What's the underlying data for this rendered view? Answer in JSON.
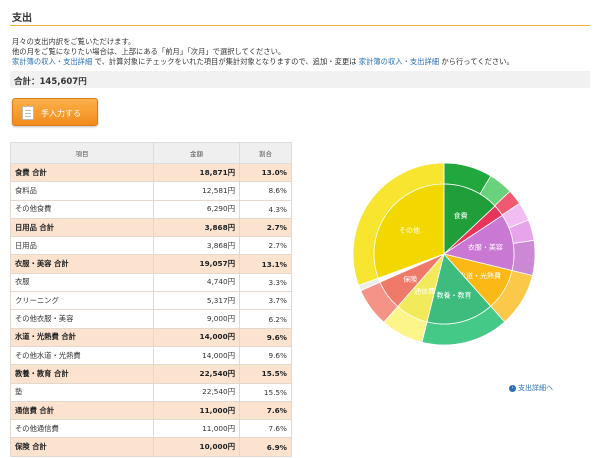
{
  "header": {
    "title": "支出"
  },
  "description": {
    "line1": "月々の支出内訳をご覧いただけます。",
    "line2": "他の月をご覧になりたい場合は、上部にある「前月」「次月」で選択してください。",
    "line3_link1": "家計簿の収入・支出詳細",
    "line3_mid": " で、計算対象にチェックをいれた項目が集計対象となりますので、追加・変更は ",
    "line3_link2": "家計簿の収入・支出詳細",
    "line3_end": " から行ってください。"
  },
  "total": {
    "label": "合計：145,607円"
  },
  "input_button": {
    "label": "手入力する",
    "icon": "note-icon"
  },
  "table": {
    "headers": [
      "項目",
      "金額",
      "割合"
    ],
    "rows": [
      {
        "type": "sub",
        "name": "食費 合計",
        "amount": "18,871円",
        "ratio": "13.0%"
      },
      {
        "type": "item",
        "name": "食料品",
        "amount": "12,581円",
        "ratio": "8.6%"
      },
      {
        "type": "item",
        "name": "その他食費",
        "amount": "6,290円",
        "ratio": "4.3%"
      },
      {
        "type": "sub",
        "name": "日用品 合計",
        "amount": "3,868円",
        "ratio": "2.7%"
      },
      {
        "type": "item",
        "name": "日用品",
        "amount": "3,868円",
        "ratio": "2.7%"
      },
      {
        "type": "sub",
        "name": "衣服・美容 合計",
        "amount": "19,057円",
        "ratio": "13.1%"
      },
      {
        "type": "item",
        "name": "衣服",
        "amount": "4,740円",
        "ratio": "3.3%"
      },
      {
        "type": "item",
        "name": "クリーニング",
        "amount": "5,317円",
        "ratio": "3.7%"
      },
      {
        "type": "item",
        "name": "その他衣服・美容",
        "amount": "9,000円",
        "ratio": "6.2%"
      },
      {
        "type": "sub",
        "name": "水道・光熱費 合計",
        "amount": "14,000円",
        "ratio": "9.6%"
      },
      {
        "type": "item",
        "name": "その他水道・光熱費",
        "amount": "14,000円",
        "ratio": "9.6%"
      },
      {
        "type": "sub",
        "name": "教養・教育 合計",
        "amount": "22,540円",
        "ratio": "15.5%"
      },
      {
        "type": "item",
        "name": "塾",
        "amount": "22,540円",
        "ratio": "15.5%"
      },
      {
        "type": "sub",
        "name": "通信費 合計",
        "amount": "11,000円",
        "ratio": "7.6%"
      },
      {
        "type": "item",
        "name": "その他通信費",
        "amount": "11,000円",
        "ratio": "7.6%"
      },
      {
        "type": "sub",
        "name": "保険 合計",
        "amount": "10,000円",
        "ratio": "6.9%"
      }
    ]
  },
  "chart_data": {
    "type": "pie",
    "start_angle_deg": 0,
    "direction": "clockwise",
    "inner": [
      {
        "label": "食費",
        "value": 13.0,
        "color": "#1f9e3a"
      },
      {
        "label": "",
        "value": 2.7,
        "color": "#e8335a"
      },
      {
        "label": "衣服・美容",
        "value": 13.1,
        "color": "#c978d4"
      },
      {
        "label": "水道・光熱費",
        "value": 9.6,
        "color": "#fcb814"
      },
      {
        "label": "教養・教育",
        "value": 15.5,
        "color": "#3ebc7e"
      },
      {
        "label": "通信費",
        "value": 7.6,
        "color": "#f1ea5a"
      },
      {
        "label": "保険",
        "value": 6.9,
        "color": "#f07a6a"
      },
      {
        "label": "",
        "value": 1.0,
        "color": "#ffffff"
      },
      {
        "label": "その他",
        "value": 30.6,
        "color": "#f2d800"
      }
    ],
    "outer": [
      {
        "value": 8.6,
        "color": "#20a73d"
      },
      {
        "value": 4.3,
        "color": "#6ad27c"
      },
      {
        "value": 2.7,
        "color": "#f05a70"
      },
      {
        "value": 3.3,
        "color": "#f2bef2"
      },
      {
        "value": 3.7,
        "color": "#e7a4ea"
      },
      {
        "value": 6.2,
        "color": "#cc88d4"
      },
      {
        "value": 9.6,
        "color": "#fcc84a"
      },
      {
        "value": 15.5,
        "color": "#45c987"
      },
      {
        "value": 7.6,
        "color": "#fbf58a"
      },
      {
        "value": 6.9,
        "color": "#f59486"
      },
      {
        "value": 1.0,
        "color": "#eeeeee"
      },
      {
        "value": 30.6,
        "color": "#f7e530"
      }
    ]
  },
  "detail_link": {
    "label": "支出詳細へ"
  }
}
